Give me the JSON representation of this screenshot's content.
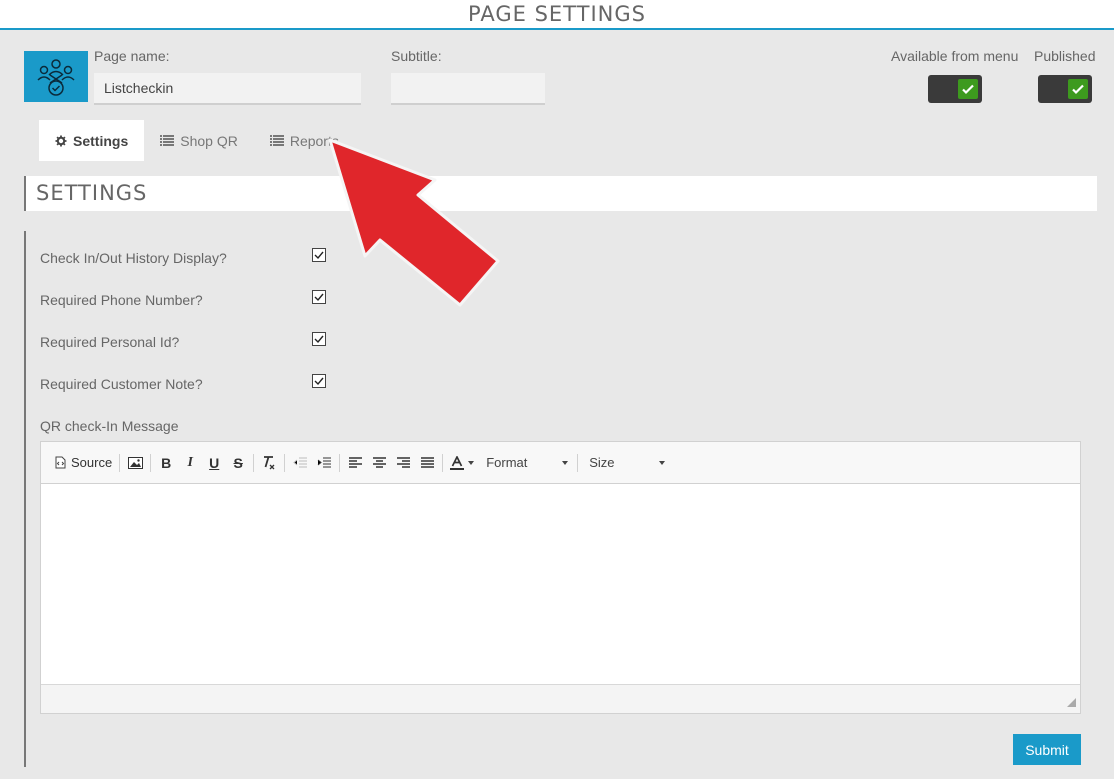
{
  "header": {
    "title": "PAGE SETTINGS"
  },
  "form": {
    "page_name_label": "Page name:",
    "page_name_value": "Listcheckin",
    "subtitle_label": "Subtitle:",
    "subtitle_value": "",
    "available_label": "Available from menu",
    "available_checked": true,
    "published_label": "Published",
    "published_checked": true
  },
  "tabs": [
    {
      "label": "Settings",
      "icon": "gear-icon",
      "active": true
    },
    {
      "label": "Shop QR",
      "icon": "list-icon",
      "active": false
    },
    {
      "label": "Reports",
      "icon": "list-icon",
      "active": false
    }
  ],
  "section": {
    "title": "SETTINGS"
  },
  "settings": [
    {
      "label": "Check In/Out History Display?",
      "checked": true
    },
    {
      "label": "Required Phone Number?",
      "checked": true
    },
    {
      "label": "Required Personal Id?",
      "checked": true
    },
    {
      "label": "Required Customer Note?",
      "checked": true
    }
  ],
  "editor": {
    "label": "QR check-In Message",
    "source_label": "Source",
    "format_label": "Format",
    "size_label": "Size",
    "content": ""
  },
  "submit_label": "Submit",
  "colors": {
    "accent": "#1a9ac9",
    "toggle_on": "#3d9a1e",
    "annotation_arrow": "#e0262b"
  }
}
